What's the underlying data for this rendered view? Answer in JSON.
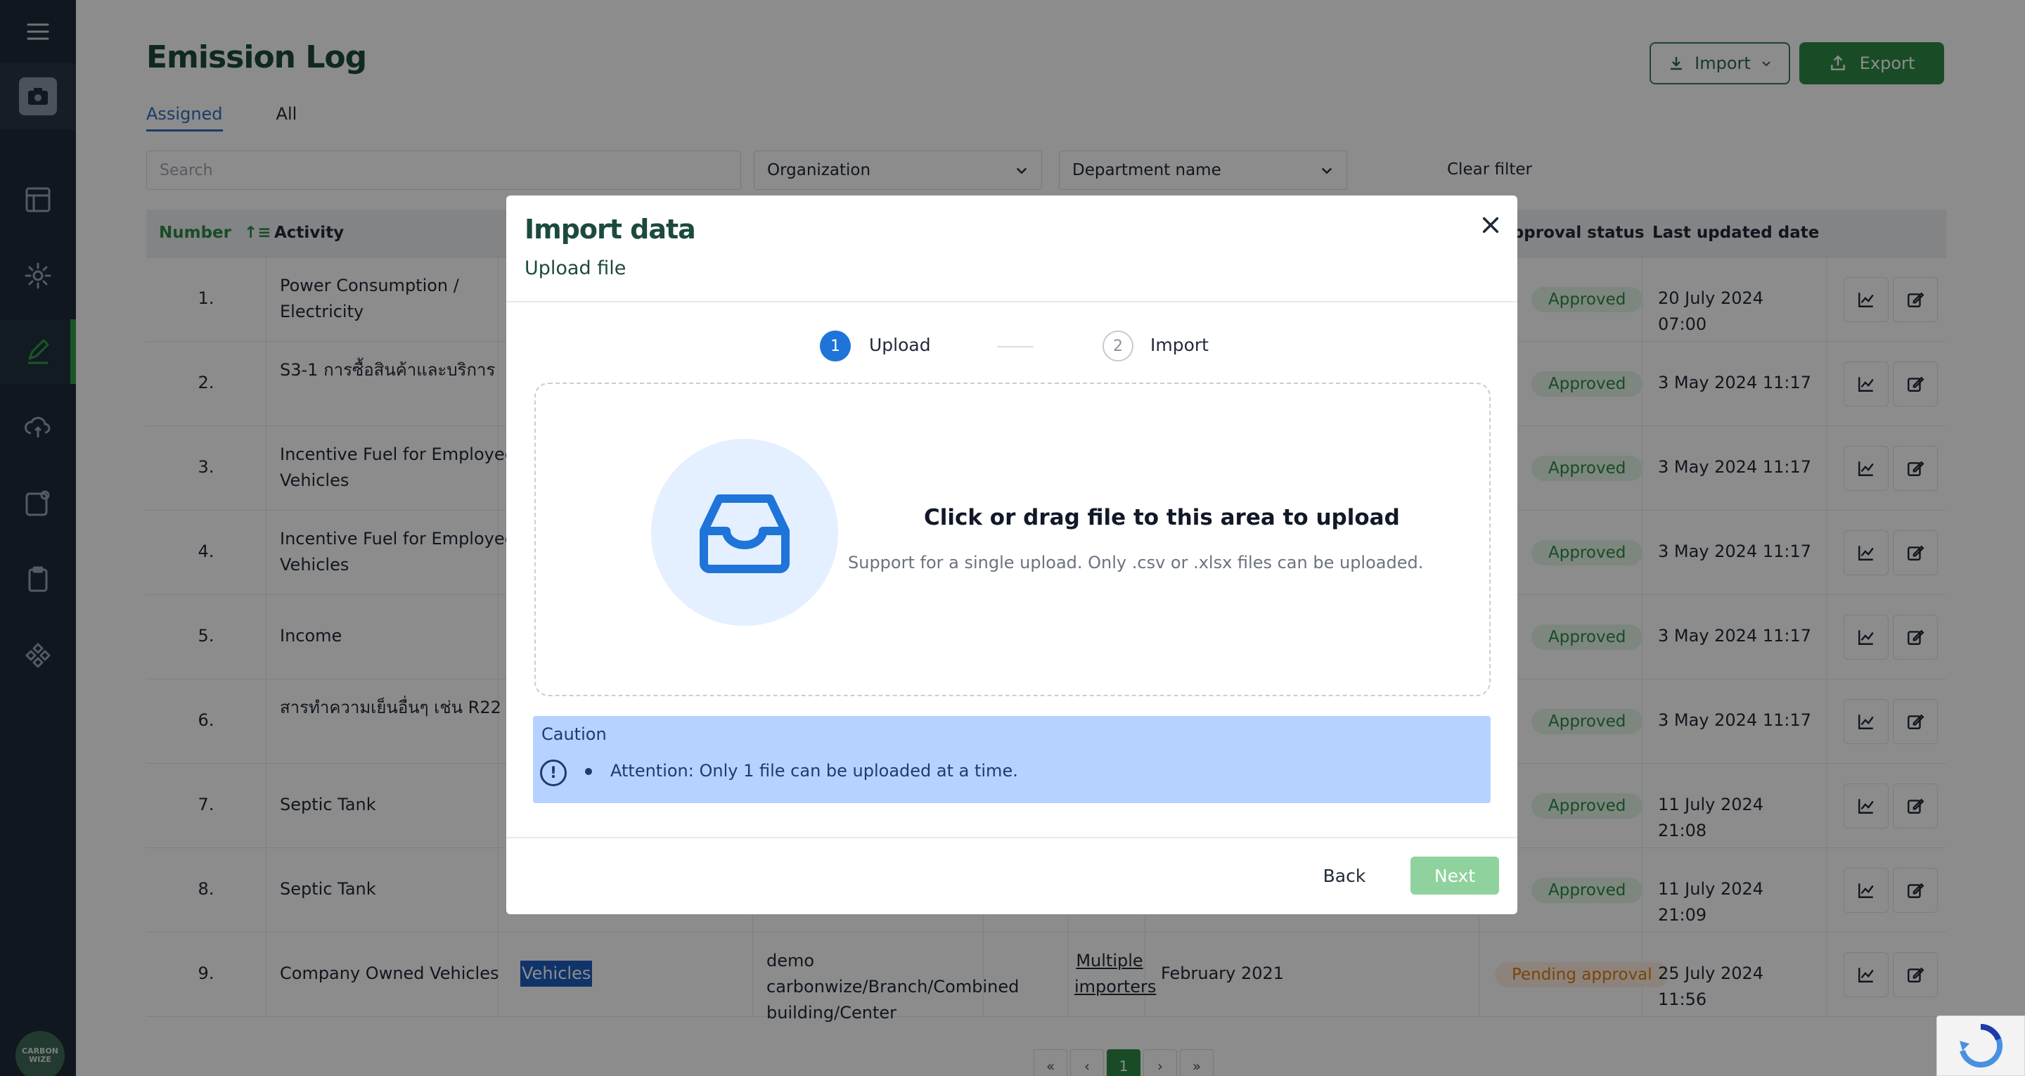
{
  "page": {
    "title": "Emission Log",
    "tabs": [
      {
        "label": "Assigned",
        "active": true
      },
      {
        "label": "All",
        "active": false
      }
    ],
    "import_label": "Import",
    "export_label": "Export",
    "search_placeholder": "Search",
    "organization_label": "Organization",
    "department_label": "Department name",
    "clear_filter": "Clear filter"
  },
  "table": {
    "headers": {
      "number": "Number",
      "activity": "Activity",
      "approval_status": "Approval status",
      "last_updated": "Last updated date"
    },
    "rows": [
      {
        "num": "1.",
        "activity": "Power Consumption / Electricity",
        "status": "Approved",
        "updated": "20 July 2024 07:00"
      },
      {
        "num": "2.",
        "activity": "S3-1 การซื้อสินค้าและบริการ",
        "status": "Approved",
        "updated": "3 May 2024 11:17"
      },
      {
        "num": "3.",
        "activity": "Incentive Fuel for Employee Vehicles",
        "status": "Approved",
        "updated": "3 May 2024 11:17"
      },
      {
        "num": "4.",
        "activity": "Incentive Fuel for Employee Vehicles",
        "status": "Approved",
        "updated": "3 May 2024 11:17"
      },
      {
        "num": "5.",
        "activity": "Income",
        "status": "Approved",
        "updated": "3 May 2024 11:17"
      },
      {
        "num": "6.",
        "activity": "สารทำความเย็นอื่นๆ เช่น R22",
        "status": "Approved",
        "updated": "3 May 2024 11:17"
      },
      {
        "num": "7.",
        "activity": "Septic Tank",
        "status": "Approved",
        "updated": "11 July 2024 21:08"
      },
      {
        "num": "8.",
        "activity": "Septic Tank",
        "status": "Approved",
        "updated": "11 July 2024 21:09"
      },
      {
        "num": "9.",
        "activity": "Company Owned Vehicles",
        "category": "Vehicles",
        "location": "demo carbonwize/Branch/Combined building/Center",
        "importer": "Multiple importers",
        "period": "February 2021",
        "status": "Pending approval",
        "updated": "25 July 2024 11:56"
      }
    ],
    "pager": {
      "first": "«",
      "prev": "‹",
      "current": "1",
      "next": "›",
      "last": "»"
    }
  },
  "modal": {
    "title": "Import data",
    "subtitle": "Upload file",
    "steps": [
      {
        "number": "1",
        "label": "Upload",
        "active": true
      },
      {
        "number": "2",
        "label": "Import",
        "active": false
      }
    ],
    "dropzone_title": "Click or drag file to this area to upload",
    "dropzone_hint": "Support for a single upload. Only .csv or .xlsx files can be uploaded.",
    "caution_title": "Caution",
    "caution_text": "Attention: Only 1 file can be uploaded at a time.",
    "back_label": "Back",
    "next_label": "Next"
  },
  "brand": {
    "logo_text": "CARBON WIZE",
    "accent": "#2e8b46",
    "step_active": "#1e74d9",
    "caution_bg": "#b6d3ff"
  }
}
